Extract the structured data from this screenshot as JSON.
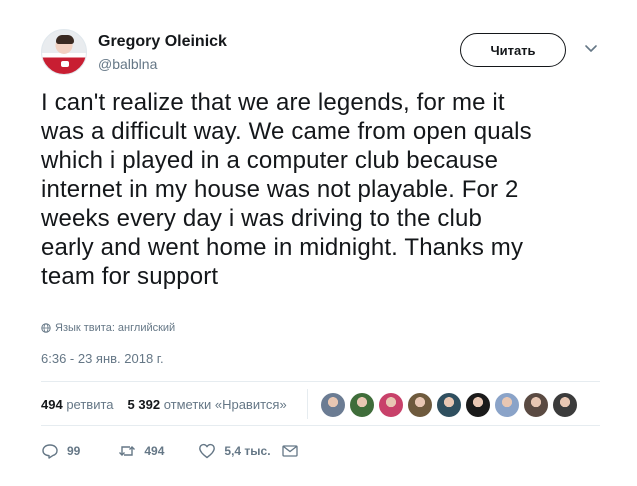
{
  "user": {
    "name": "Gregory Oleinick",
    "handle": "@balblna"
  },
  "follow_button": {
    "label": "Читать"
  },
  "tweet": {
    "text_lines": [
      "I can't realize that we are legends, for me it",
      "was a difficult way. We came from open quals",
      "which i played in a computer club because",
      "internet in my house was not playable. For 2",
      "weeks every day i was driving to the club",
      "early and went home in midnight. Thanks my",
      "team for support"
    ],
    "language_note": "Язык твита: английский",
    "timestamp": "6:36 - 23 янв. 2018 г."
  },
  "stats": {
    "retweets_count": "494",
    "retweets_label": "ретвита",
    "likes_count": "5 392",
    "likes_label": "отметки «Нравится»"
  },
  "likers": [
    {
      "name": "liker-1",
      "color": "#6b7c93"
    },
    {
      "name": "liker-2",
      "color": "#3f6d3a"
    },
    {
      "name": "liker-3",
      "color": "#c8416a"
    },
    {
      "name": "liker-4",
      "color": "#6e5a3d"
    },
    {
      "name": "liker-5",
      "color": "#2f4f5f"
    },
    {
      "name": "liker-6",
      "color": "#1a1a1a"
    },
    {
      "name": "liker-7",
      "color": "#8aa3c8"
    },
    {
      "name": "liker-8",
      "color": "#5a4a42"
    },
    {
      "name": "liker-9",
      "color": "#3b3b3b"
    }
  ],
  "actions": {
    "reply_count": "99",
    "retweet_count": "494",
    "like_count": "5,4 тыс."
  },
  "colors": {
    "text_primary": "#14171a",
    "text_secondary": "#657786",
    "divider": "#e6ecf0"
  },
  "icons": {
    "globe": "globe-icon",
    "reply": "reply-icon",
    "retweet": "retweet-icon",
    "like": "heart-icon",
    "message": "envelope-icon",
    "caret": "chevron-down-icon"
  }
}
